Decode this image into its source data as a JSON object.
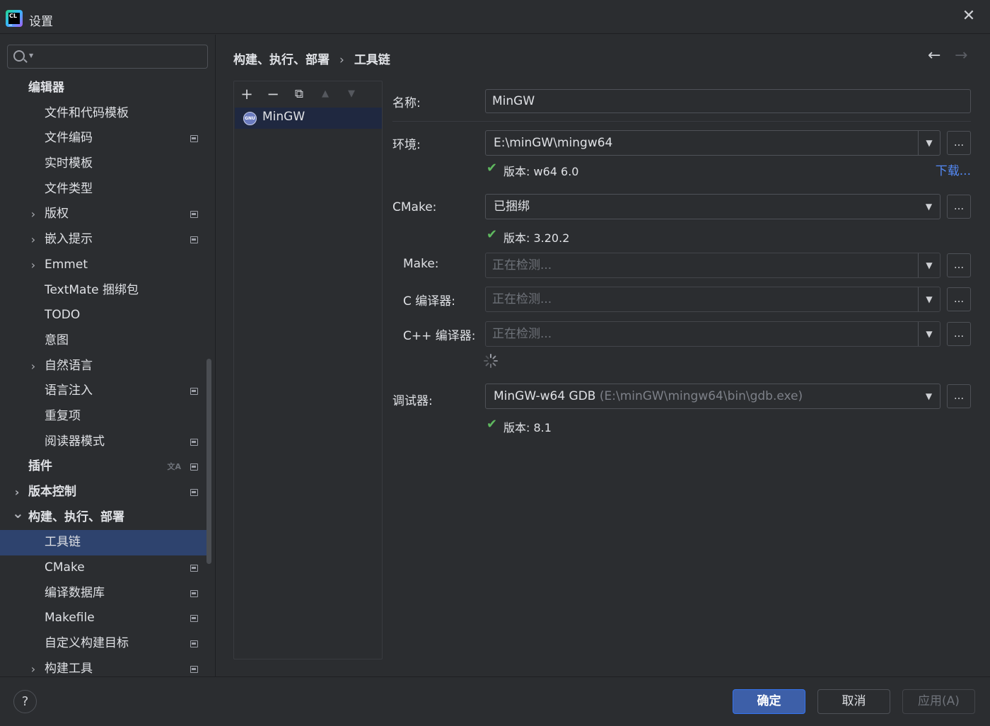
{
  "window": {
    "title": "设置"
  },
  "search": {
    "placeholder": ""
  },
  "sidebar": {
    "items": [
      {
        "label": "编辑器",
        "level": 0,
        "bold": true,
        "chevron": "",
        "project": false
      },
      {
        "label": "文件和代码模板",
        "level": 1,
        "bold": false,
        "chevron": "",
        "project": false
      },
      {
        "label": "文件编码",
        "level": 1,
        "bold": false,
        "chevron": "",
        "project": true
      },
      {
        "label": "实时模板",
        "level": 1,
        "bold": false,
        "chevron": "",
        "project": false
      },
      {
        "label": "文件类型",
        "level": 1,
        "bold": false,
        "chevron": "",
        "project": false
      },
      {
        "label": "版权",
        "level": 1,
        "bold": false,
        "chevron": "right",
        "project": true
      },
      {
        "label": "嵌入提示",
        "level": 1,
        "bold": false,
        "chevron": "right",
        "project": true
      },
      {
        "label": "Emmet",
        "level": 1,
        "bold": false,
        "chevron": "right",
        "project": false
      },
      {
        "label": "TextMate 捆绑包",
        "level": 1,
        "bold": false,
        "chevron": "",
        "project": false
      },
      {
        "label": "TODO",
        "level": 1,
        "bold": false,
        "chevron": "",
        "project": false
      },
      {
        "label": "意图",
        "level": 1,
        "bold": false,
        "chevron": "",
        "project": false
      },
      {
        "label": "自然语言",
        "level": 1,
        "bold": false,
        "chevron": "right",
        "project": false
      },
      {
        "label": "语言注入",
        "level": 1,
        "bold": false,
        "chevron": "",
        "project": true
      },
      {
        "label": "重复项",
        "level": 1,
        "bold": false,
        "chevron": "",
        "project": false
      },
      {
        "label": "阅读器模式",
        "level": 1,
        "bold": false,
        "chevron": "",
        "project": true
      },
      {
        "label": "插件",
        "level": 0,
        "bold": true,
        "chevron": "",
        "project": true,
        "translate": true
      },
      {
        "label": "版本控制",
        "level": 0,
        "bold": true,
        "chevron": "right",
        "project": true
      },
      {
        "label": "构建、执行、部署",
        "level": 0,
        "bold": true,
        "chevron": "down",
        "project": false
      },
      {
        "label": "工具链",
        "level": 1,
        "bold": false,
        "chevron": "",
        "project": false,
        "selected": true
      },
      {
        "label": "CMake",
        "level": 1,
        "bold": false,
        "chevron": "",
        "project": true
      },
      {
        "label": "编译数据库",
        "level": 1,
        "bold": false,
        "chevron": "",
        "project": true
      },
      {
        "label": "Makefile",
        "level": 1,
        "bold": false,
        "chevron": "",
        "project": true
      },
      {
        "label": "自定义构建目标",
        "level": 1,
        "bold": false,
        "chevron": "",
        "project": true
      },
      {
        "label": "构建工具",
        "level": 1,
        "bold": false,
        "chevron": "right",
        "project": true
      }
    ]
  },
  "breadcrumb": {
    "parent": "构建、执行、部署",
    "separator": "›",
    "current": "工具链"
  },
  "toolchains": {
    "items": [
      {
        "label": "MinGW",
        "icon": "gnu-icon"
      }
    ]
  },
  "form": {
    "name_label": "名称:",
    "name_value": "MinGW",
    "env_label": "环境:",
    "env_value": "E:\\minGW\\mingw64",
    "env_version": "版本: w64 6.0",
    "download_link": "下载...",
    "cmake_label": "CMake:",
    "cmake_value": "已捆绑",
    "cmake_version": "版本: 3.20.2",
    "make_label": "Make:",
    "make_placeholder": "正在检测...",
    "c_label": "C 编译器:",
    "c_placeholder": "正在检测...",
    "cpp_label": "C++ 编译器:",
    "cpp_placeholder": "正在检测...",
    "debugger_label": "调试器:",
    "debugger_value": "MinGW-w64 GDB",
    "debugger_path": "(E:\\minGW\\mingw64\\bin\\gdb.exe)",
    "debugger_version": "版本: 8.1",
    "browse_label": "..."
  },
  "footer": {
    "help": "?",
    "ok": "确定",
    "cancel": "取消",
    "apply": "应用(A)"
  },
  "colors": {
    "background": "#2b2d30",
    "selection": "#2e436e",
    "primary_button": "#3d5fa8",
    "link": "#548af7",
    "check": "#5fb85f"
  }
}
